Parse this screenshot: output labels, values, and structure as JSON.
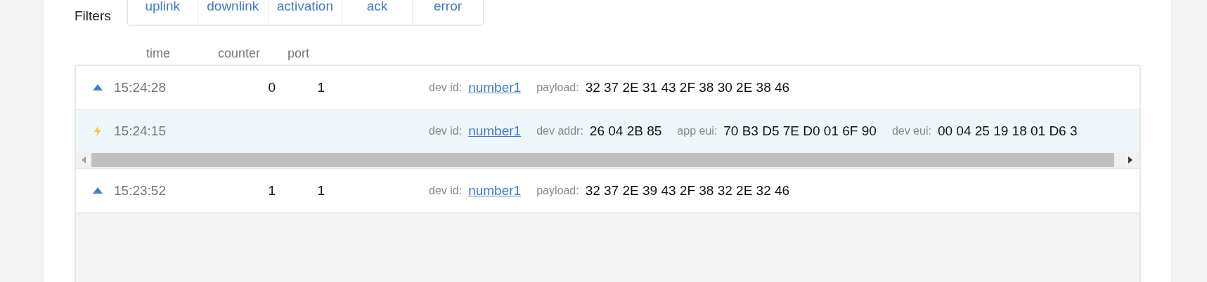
{
  "filters": {
    "label": "Filters",
    "tabs": [
      {
        "label": "uplink",
        "selected": false
      },
      {
        "label": "downlink",
        "selected": false
      },
      {
        "label": "activation",
        "selected": false
      },
      {
        "label": "ack",
        "selected": false
      },
      {
        "label": "error",
        "selected": false
      }
    ]
  },
  "table": {
    "columns": [
      "time",
      "counter",
      "port"
    ],
    "rows": [
      {
        "kind": "uplink",
        "time": "15:24:28",
        "counter": "0",
        "port": "1",
        "fields": [
          {
            "label": "dev id:",
            "value": "number1",
            "kind": "link"
          },
          {
            "label": "payload:",
            "value": "32 37 2E 31 43 2F 38 30 2E 38 46",
            "kind": "text"
          }
        ]
      },
      {
        "kind": "activation",
        "time": "15:24:15",
        "counter": "",
        "port": "",
        "fields": [
          {
            "label": "dev id:",
            "value": "number1",
            "kind": "link"
          },
          {
            "label": "dev addr:",
            "value": "26 04 2B 85",
            "kind": "text"
          },
          {
            "label": "app eui:",
            "value": "70 B3 D5 7E D0 01 6F 90",
            "kind": "text"
          },
          {
            "label": "dev eui:",
            "value": "00 04 25 19 18 01 D6 3",
            "kind": "text"
          }
        ]
      },
      {
        "kind": "uplink",
        "time": "15:23:52",
        "counter": "1",
        "port": "1",
        "fields": [
          {
            "label": "dev id:",
            "value": "number1",
            "kind": "link"
          },
          {
            "label": "payload:",
            "value": "32 37 2E 39 43 2F 38 32 2E 32 46",
            "kind": "text"
          }
        ]
      }
    ]
  }
}
